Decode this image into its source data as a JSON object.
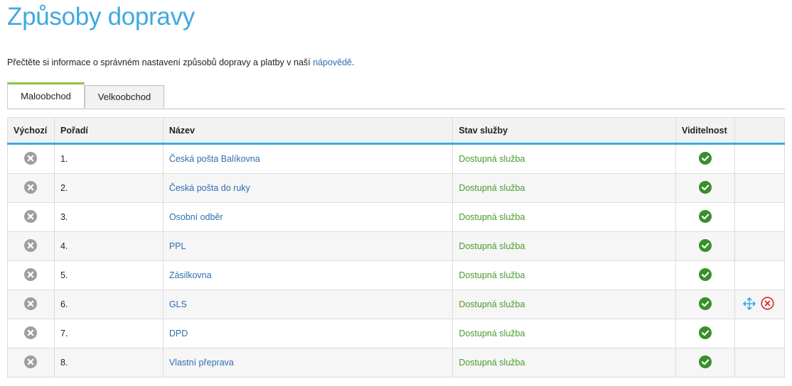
{
  "page": {
    "title": "Způsoby dopravy",
    "intro_text": "Přečtěte si informace o správném nastavení způsobů dopravy a platby v naší ",
    "intro_link": "nápovědě",
    "intro_end": "."
  },
  "tabs": [
    {
      "label": "Maloobchod",
      "active": true
    },
    {
      "label": "Velkoobchod",
      "active": false
    }
  ],
  "table": {
    "headers": {
      "default": "Výchozí",
      "order": "Pořadí",
      "name": "Název",
      "status": "Stav služby",
      "visibility": "Viditelnost",
      "actions": ""
    },
    "rows": [
      {
        "order": "1.",
        "name": "Česká pošta Balíkovna",
        "status": "Dostupná služba"
      },
      {
        "order": "2.",
        "name": "Česká pošta do ruky",
        "status": "Dostupná služba"
      },
      {
        "order": "3.",
        "name": "Osobní odběr",
        "status": "Dostupná služba"
      },
      {
        "order": "4.",
        "name": "PPL",
        "status": "Dostupná služba"
      },
      {
        "order": "5.",
        "name": "Zásilkovna",
        "status": "Dostupná služba"
      },
      {
        "order": "6.",
        "name": "GLS",
        "status": "Dostupná služba"
      },
      {
        "order": "7.",
        "name": "DPD",
        "status": "Dostupná služba"
      },
      {
        "order": "8.",
        "name": "Vlastní přeprava",
        "status": "Dostupná služba"
      }
    ]
  },
  "icons": {
    "default_toggle": "x-circle-gray-icon",
    "visible": "check-circle-green-icon",
    "move": "move-arrows-icon",
    "delete": "delete-circle-icon"
  },
  "colors": {
    "title": "#3fa9e0",
    "link": "#2f6db3",
    "status_ok": "#4a9a2e",
    "active_tab_accent": "#8cc63f",
    "header_underline": "#3fa9e0",
    "delete_red": "#e0252b"
  }
}
